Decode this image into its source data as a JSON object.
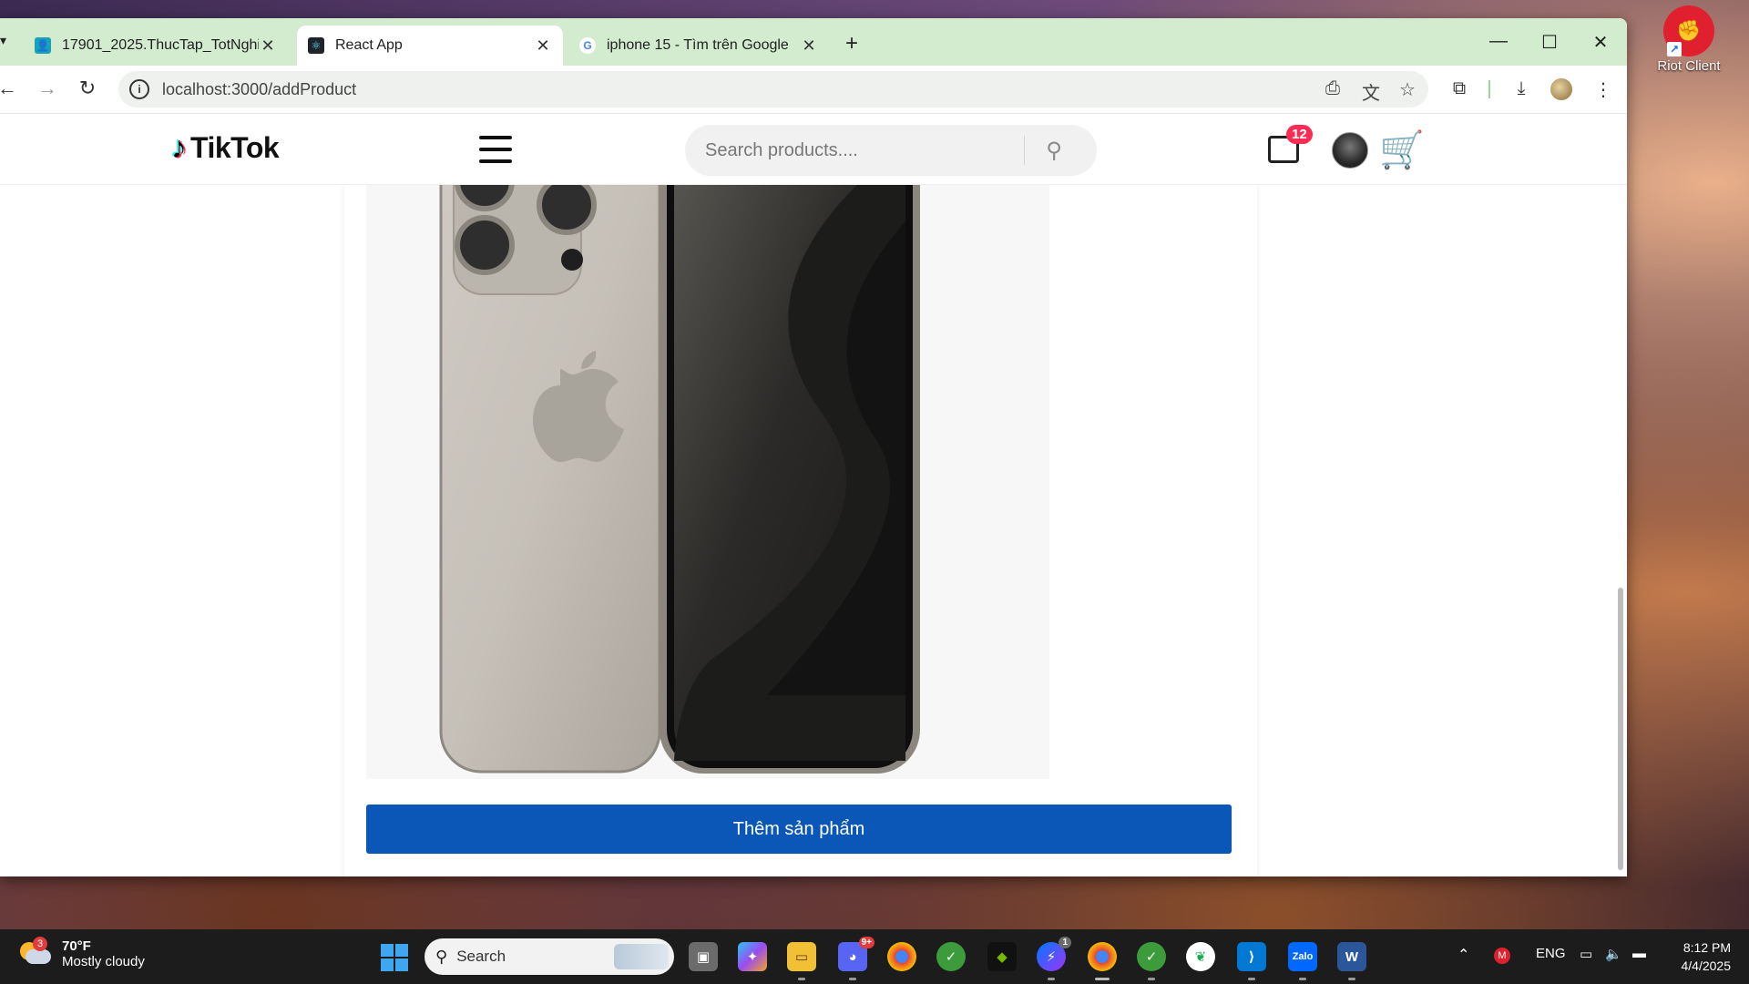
{
  "desktop": {
    "icon_label": "Riot Client"
  },
  "browser": {
    "tabs": [
      {
        "title": "17901_2025.ThucTap_TotNghiep",
        "active": false
      },
      {
        "title": "React App",
        "active": true
      },
      {
        "title": "iphone 15 - Tìm trên Google",
        "active": false
      }
    ],
    "url": "localhost:3000/addProduct"
  },
  "site": {
    "brand": "TikTok",
    "search_placeholder": "Search products....",
    "message_count": "12",
    "add_button_label": "Thêm sản phẩm"
  },
  "taskbar": {
    "weather_temp": "70°F",
    "weather_desc": "Mostly cloudy",
    "weather_badge": "3",
    "search_label": "Search",
    "discord_badge": "9+",
    "messenger_badge": "1",
    "language": "ENG",
    "time": "8:12 PM",
    "date": "4/4/2025"
  },
  "colors": {
    "accent_button": "#0a57b8",
    "tab_strip": "#d3ecd0",
    "badge": "#fe2c55"
  }
}
